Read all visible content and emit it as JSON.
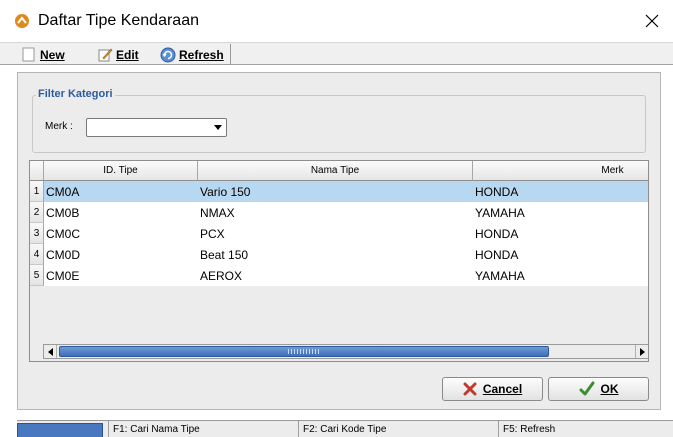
{
  "window": {
    "title": "Daftar Tipe Kendaraan"
  },
  "toolbar": {
    "new_label": "New",
    "edit_label": "Edit",
    "refresh_label": "Refresh"
  },
  "filter": {
    "legend": "Filter Kategori",
    "merk_label": "Merk :",
    "merk_value": ""
  },
  "table": {
    "columns": [
      "ID. Tipe",
      "Nama Tipe",
      "Merk"
    ],
    "rows": [
      {
        "num": "1",
        "id": "CM0A",
        "nama": "Vario 150",
        "merk": "HONDA",
        "selected": true
      },
      {
        "num": "2",
        "id": "CM0B",
        "nama": "NMAX",
        "merk": "YAMAHA",
        "selected": false
      },
      {
        "num": "3",
        "id": "CM0C",
        "nama": "PCX",
        "merk": "HONDA",
        "selected": false
      },
      {
        "num": "4",
        "id": "CM0D",
        "nama": "Beat 150",
        "merk": "HONDA",
        "selected": false
      },
      {
        "num": "5",
        "id": "CM0E",
        "nama": "AEROX",
        "merk": "YAMAHA",
        "selected": false
      }
    ]
  },
  "buttons": {
    "cancel_label": "Cancel",
    "ok_label": "OK"
  },
  "statusbar": {
    "items": [
      "F1: Cari Nama Tipe",
      "F2: Cari Kode Tipe",
      "F5: Refresh"
    ]
  },
  "colors": {
    "selection": "#b8d7f1",
    "legend": "#2f5a9e",
    "scroll_thumb": "#3e6fb8",
    "cancel_x": "#c0392b",
    "ok_check": "#3a8f2a",
    "app_icon": "#e08a1e"
  },
  "icons": {
    "app": "app-logo-icon",
    "close": "close-icon",
    "new": "new-document-icon",
    "edit": "edit-pencil-icon",
    "refresh": "refresh-icon",
    "cancel": "cancel-x-icon",
    "ok": "ok-check-icon"
  }
}
